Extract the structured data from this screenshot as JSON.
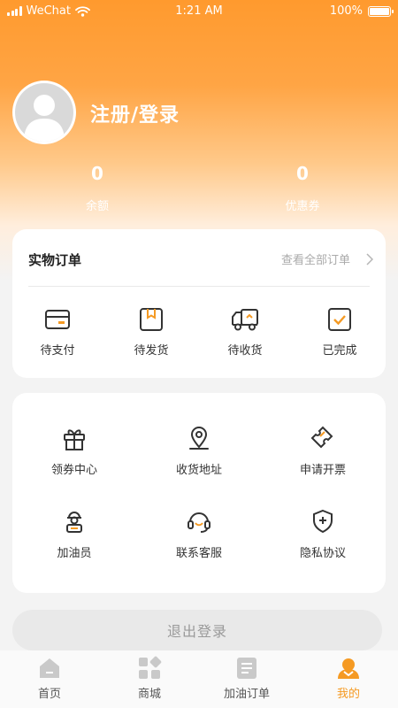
{
  "status_bar": {
    "carrier": "WeChat",
    "time": "1:21 AM",
    "battery": "100%"
  },
  "profile": {
    "login_label": "注册/登录"
  },
  "stats": [
    {
      "value": "0",
      "label": "余额"
    },
    {
      "value": "0",
      "label": "优惠券"
    }
  ],
  "orders": {
    "title": "实物订单",
    "view_all": "查看全部订单",
    "items": [
      {
        "label": "待支付",
        "icon": "wallet-card-icon"
      },
      {
        "label": "待发货",
        "icon": "package-box-icon"
      },
      {
        "label": "待收货",
        "icon": "delivery-truck-icon"
      },
      {
        "label": "已完成",
        "icon": "check-square-icon"
      }
    ]
  },
  "services": {
    "items": [
      {
        "label": "领券中心",
        "icon": "gift-icon"
      },
      {
        "label": "收货地址",
        "icon": "location-pin-icon"
      },
      {
        "label": "申请开票",
        "icon": "ticket-icon"
      },
      {
        "label": "加油员",
        "icon": "attendant-icon"
      },
      {
        "label": "联系客服",
        "icon": "headset-icon"
      },
      {
        "label": "隐私协议",
        "icon": "shield-plus-icon"
      }
    ]
  },
  "logout": {
    "label": "退出登录"
  },
  "tabbar": {
    "items": [
      {
        "label": "首页",
        "icon": "home-icon"
      },
      {
        "label": "商城",
        "icon": "mall-icon"
      },
      {
        "label": "加油订单",
        "icon": "fuel-order-icon"
      },
      {
        "label": "我的",
        "icon": "profile-icon"
      }
    ],
    "active_index": 3
  },
  "colors": {
    "accent": "#f59a23",
    "hero_top": "#ff9a2e",
    "icon_inactive": "#c9c9c9"
  }
}
